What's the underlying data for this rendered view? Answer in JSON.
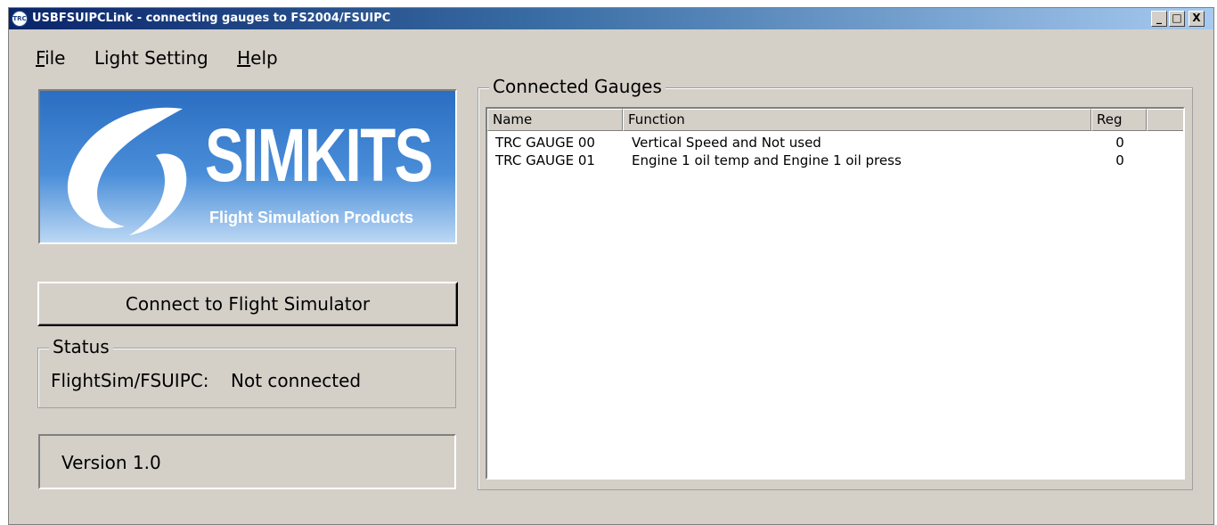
{
  "window": {
    "title": "USBFSUIPCLink - connecting gauges to FS2004/FSUIPC",
    "icon_text": "TRC",
    "controls": {
      "minimize": "_",
      "maximize": "□",
      "close": "X"
    }
  },
  "menu": {
    "items": [
      {
        "label": "File"
      },
      {
        "label": "Light Setting"
      },
      {
        "label": "Help"
      }
    ]
  },
  "logo": {
    "brand": "SIMKITS",
    "tagline": "Flight Simulation Products",
    "colors": {
      "top": "#2b6ec2",
      "bottom": "#bcd8f4"
    }
  },
  "connect_button": {
    "label": "Connect to Flight Simulator"
  },
  "status": {
    "group_label": "Status",
    "key": "FlightSim/FSUIPC:",
    "value": "Not connected"
  },
  "version": {
    "text": "Version 1.0"
  },
  "gauges": {
    "group_label": "Connected Gauges",
    "columns": [
      "Name",
      "Function",
      "Reg",
      ""
    ],
    "rows": [
      {
        "name": "TRC GAUGE 00",
        "function": "Vertical Speed and Not used",
        "reg": "0"
      },
      {
        "name": "TRC GAUGE 01",
        "function": "Engine 1 oil temp and Engine 1 oil press",
        "reg": "0"
      }
    ]
  }
}
